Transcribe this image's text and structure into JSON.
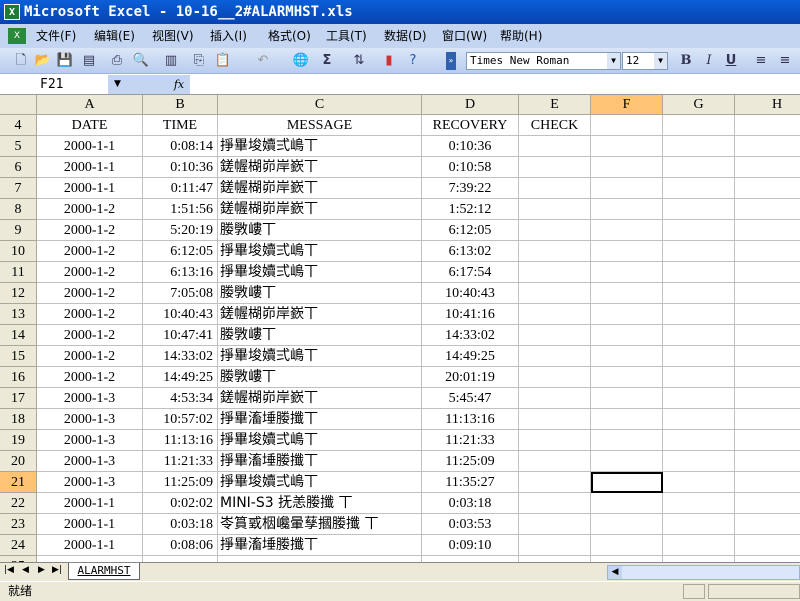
{
  "window": {
    "title": "Microsoft Excel - 10-16__2#ALARMHST.xls"
  },
  "menu": [
    "文件(F)",
    "编辑(E)",
    "视图(V)",
    "插入(I)",
    "格式(O)",
    "工具(T)",
    "数据(D)",
    "窗口(W)",
    "帮助(H)"
  ],
  "toolbar": {
    "font": "Times New Roman",
    "size": "12",
    "bold": "B",
    "italic": "I",
    "underline": "U",
    "sum": "Σ"
  },
  "formula": {
    "cell_ref": "F21",
    "fx": "fx",
    "value": ""
  },
  "columns": [
    "A",
    "B",
    "C",
    "D",
    "E",
    "F",
    "G",
    "H"
  ],
  "selected_column": "F",
  "selected_row": "21",
  "header_row": {
    "row": "4",
    "cells": [
      "DATE",
      "TIME",
      "MESSAGE",
      "RECOVERY",
      "CHECK"
    ]
  },
  "rows": [
    {
      "row": "5",
      "date": "2000-1-1",
      "time": "0:08:14",
      "message": "掙畢埈嬻弍嶋丅",
      "recovery": "0:10:36"
    },
    {
      "row": "6",
      "date": "2000-1-1",
      "time": "0:10:36",
      "message": "鎈幄楜峁岸嶔丅",
      "recovery": "0:10:58"
    },
    {
      "row": "7",
      "date": "2000-1-1",
      "time": "0:11:47",
      "message": "鎈幄楜峁岸嶔丅",
      "recovery": "7:39:22"
    },
    {
      "row": "8",
      "date": "2000-1-2",
      "time": "1:51:56",
      "message": "鎈幄楜峁岸嶔丅",
      "recovery": "1:52:12"
    },
    {
      "row": "9",
      "date": "2000-1-2",
      "time": "5:20:19",
      "message": " 媵斆嶁丅",
      "recovery": "6:12:05"
    },
    {
      "row": "10",
      "date": "2000-1-2",
      "time": "6:12:05",
      "message": "掙畢埈嬻弍嶋丅",
      "recovery": "6:13:02"
    },
    {
      "row": "11",
      "date": "2000-1-2",
      "time": "6:13:16",
      "message": "掙畢埈嬻弍嶋丅",
      "recovery": "6:17:54"
    },
    {
      "row": "12",
      "date": "2000-1-2",
      "time": "7:05:08",
      "message": " 媵斆嶁丅",
      "recovery": "10:40:43"
    },
    {
      "row": "13",
      "date": "2000-1-2",
      "time": "10:40:43",
      "message": "鎈幄楜峁岸嶔丅",
      "recovery": "10:41:16"
    },
    {
      "row": "14",
      "date": "2000-1-2",
      "time": "10:47:41",
      "message": " 媵斆嶁丅",
      "recovery": "14:33:02"
    },
    {
      "row": "15",
      "date": "2000-1-2",
      "time": "14:33:02",
      "message": "掙畢埈嬻弍嶋丅",
      "recovery": "14:49:25"
    },
    {
      "row": "16",
      "date": "2000-1-2",
      "time": "14:49:25",
      "message": " 媵斆嶁丅",
      "recovery": "20:01:19"
    },
    {
      "row": "17",
      "date": "2000-1-3",
      "time": "4:53:34",
      "message": "鎈幄楜峁岸嶔丅",
      "recovery": "5:45:47"
    },
    {
      "row": "18",
      "date": "2000-1-3",
      "time": "10:57:02",
      "message": "掙畢滀埵媵攕丅",
      "recovery": "11:13:16"
    },
    {
      "row": "19",
      "date": "2000-1-3",
      "time": "11:13:16",
      "message": "掙畢埈嬻弍嶋丅",
      "recovery": "11:21:33"
    },
    {
      "row": "20",
      "date": "2000-1-3",
      "time": "11:21:33",
      "message": "掙畢滀埵媵攕丅",
      "recovery": "11:25:09"
    },
    {
      "row": "21",
      "date": "2000-1-3",
      "time": "11:25:09",
      "message": "掙畢埈嬻弍嶋丅",
      "recovery": "11:35:27"
    },
    {
      "row": "22",
      "date": "2000-1-1",
      "time": "0:02:02",
      "message": "MINI-S3 抚恙媵攕 丅",
      "recovery": "0:03:18"
    },
    {
      "row": "23",
      "date": "2000-1-1",
      "time": "0:03:18",
      "message": "岺篔戜栶巉暈孶摑媵攕 丅",
      "recovery": "0:03:53"
    },
    {
      "row": "24",
      "date": "2000-1-1",
      "time": "0:08:06",
      "message": "掙畢滀埵媵攕丅",
      "recovery": "0:09:10"
    },
    {
      "row": "25",
      "date": "",
      "time": "",
      "message": "",
      "recovery": ""
    }
  ],
  "sheet_tabs": [
    "ALARMHST"
  ],
  "status": "就绪",
  "colors": {
    "title_bar": "#0a5fd8",
    "selection_header": "#ffc374",
    "menu_bg": "#c3d5f0"
  }
}
